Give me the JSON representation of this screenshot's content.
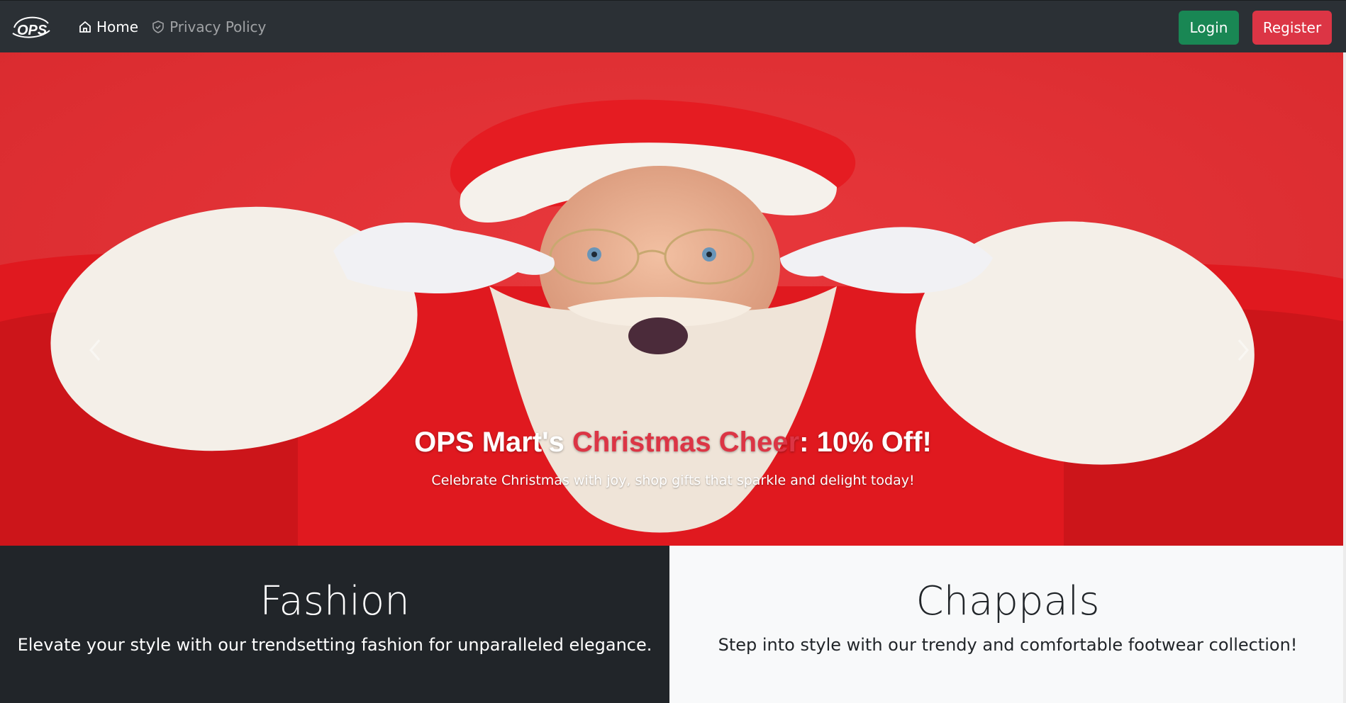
{
  "navbar": {
    "brand": "OPS",
    "links": [
      {
        "label": "Home",
        "icon": "house-icon",
        "active": true
      },
      {
        "label": "Privacy Policy",
        "icon": "shield-icon",
        "active": false
      }
    ],
    "login_label": "Login",
    "register_label": "Register"
  },
  "hero": {
    "title_part1": "OPS Mart's ",
    "title_accent": "Christmas Cheer",
    "title_part2": ": 10% Off!",
    "subtitle": "Celebrate Christmas with joy, shop gifts that sparkle and delight today!",
    "prev_icon": "chevron-left-icon",
    "next_icon": "chevron-right-icon"
  },
  "features": {
    "fashion": {
      "title": "Fashion",
      "text": "Elevate your style with our trendsetting fashion for unparalleled elegance."
    },
    "chappals": {
      "title": "Chappals",
      "text": "Step into style with our trendy and comfortable footwear collection!"
    }
  },
  "colors": {
    "navbar_bg": "#2b3035",
    "login": "#198754",
    "register": "#dc3545",
    "accent": "#dc3545",
    "dark_section": "#212529",
    "light_section": "#f8f9fa"
  }
}
